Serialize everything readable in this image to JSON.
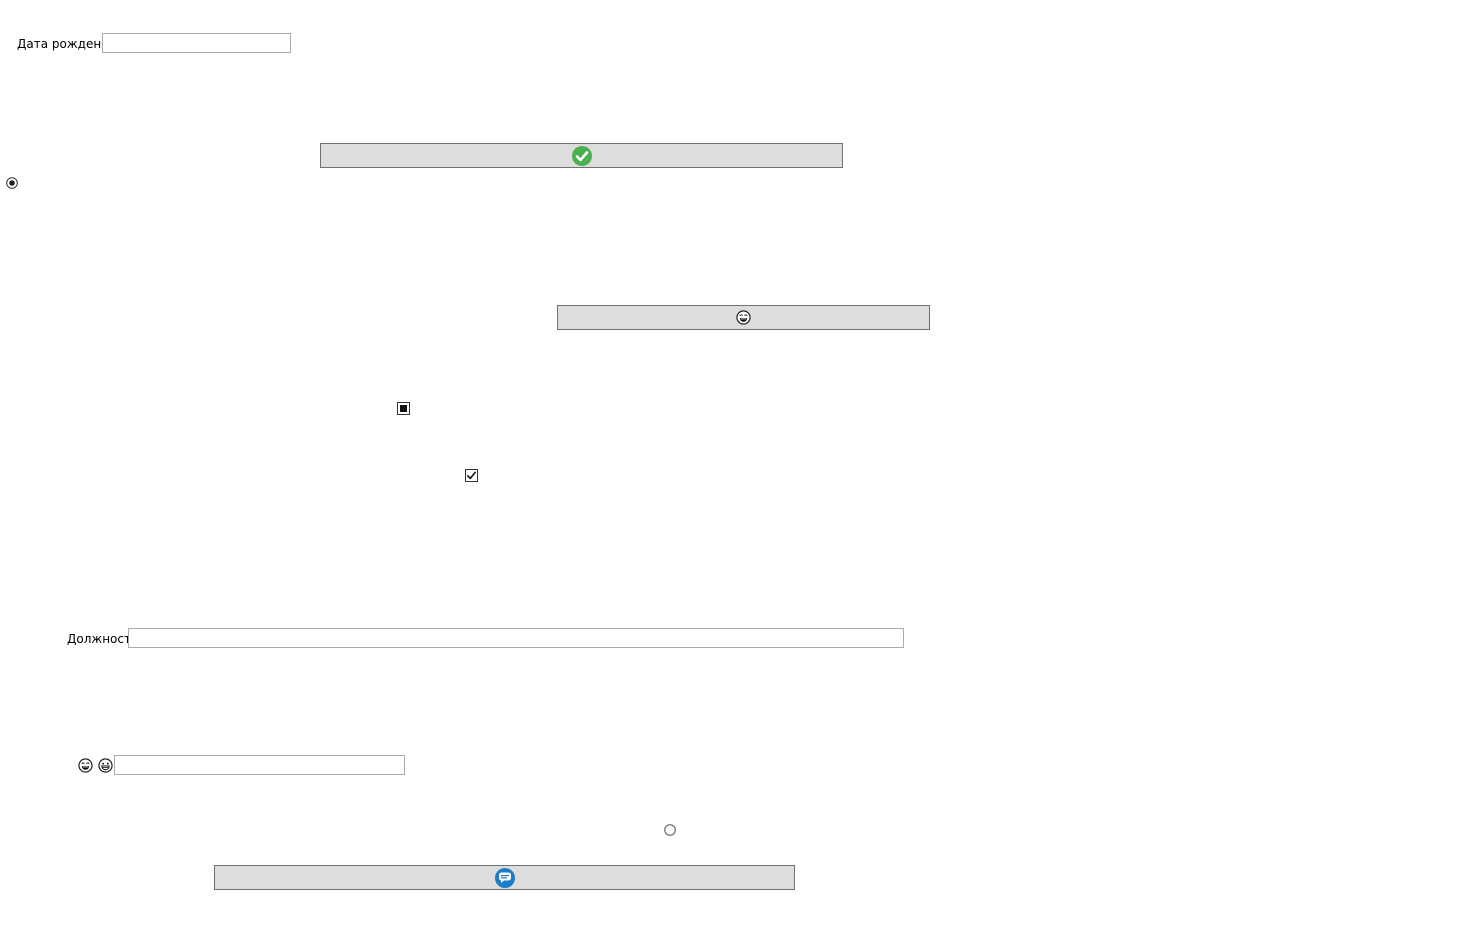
{
  "form": {
    "birth_date": {
      "label": "Дата рождения",
      "value": "",
      "placeholder": ""
    },
    "position": {
      "label": "Должность",
      "value": "",
      "placeholder": ""
    },
    "emoji_field": {
      "value": "",
      "placeholder": ""
    }
  },
  "controls": {
    "confirm_button": {
      "icon": "check-circle-icon",
      "icon_color": "#4caf50"
    },
    "face_button": {
      "icon": "laughing-face-icon"
    },
    "chat_button": {
      "icon": "blue-chat-icon",
      "icon_color": "#1e7dc8"
    },
    "radio_top": {
      "checked": true
    },
    "radio_bottom": {
      "checked": false
    },
    "checkbox_indeterminate": {
      "state": "indeterminate"
    },
    "checkbox_checked": {
      "state": "checked"
    }
  },
  "colors": {
    "button_bg": "#dddddd",
    "button_border": "#707070",
    "textbox_border": "#ababab"
  }
}
